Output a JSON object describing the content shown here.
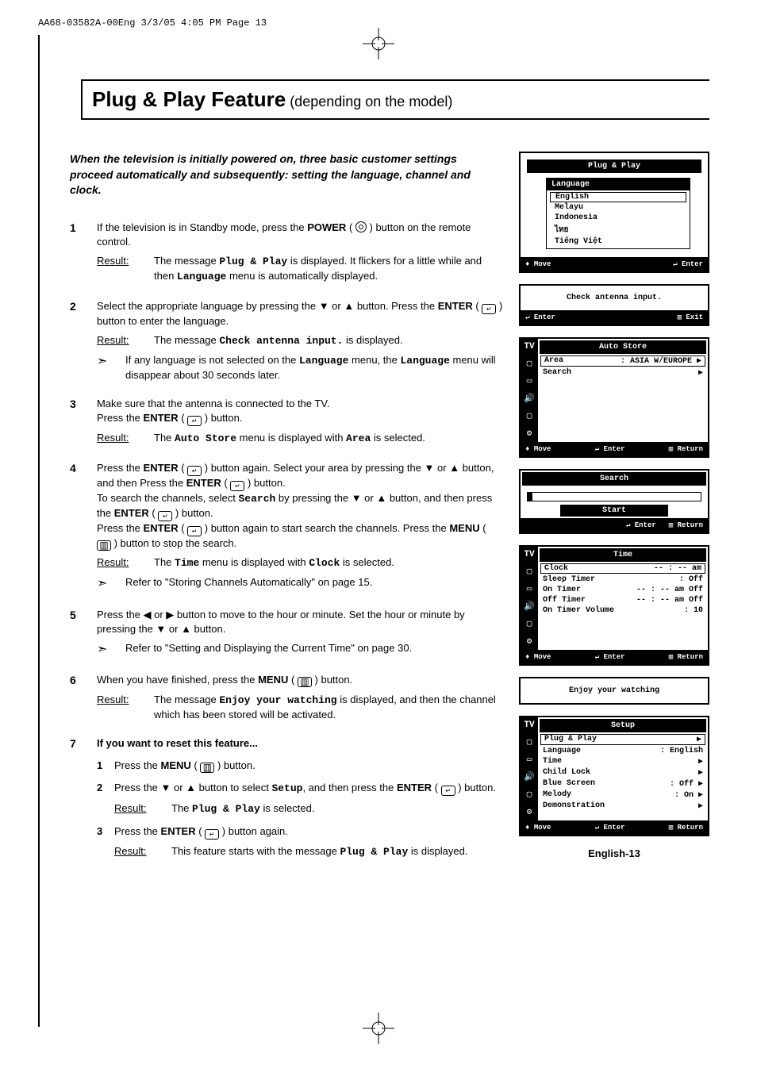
{
  "meta": {
    "header": "AA68-03582A-00Eng  3/3/05  4:05 PM  Page 13"
  },
  "title": {
    "main": "Plug & Play Feature",
    "sub": " (depending on the model)"
  },
  "intro": "When the television is initially powered on, three basic customer settings proceed automatically and subsequently: setting the language, channel and clock.",
  "steps": {
    "s1": {
      "num": "1",
      "body_a": "If the television is in Standby mode, press the ",
      "body_b": "POWER",
      "body_c": " ( ",
      "body_d": " ) button on the remote control.",
      "result_label": "Result:",
      "result_a": "The message ",
      "result_b": "Plug & Play",
      "result_c": " is displayed. It flickers for a little while and then ",
      "result_d": "Language",
      "result_e": " menu is automatically displayed."
    },
    "s2": {
      "num": "2",
      "body_a": "Select the appropriate language by pressing the ▼ or ▲  button. Press the ",
      "body_b": "ENTER",
      "body_c": " ( ",
      "body_d": " ) button to enter the language.",
      "result_label": "Result:",
      "result_a": "The message ",
      "result_b": "Check antenna input.",
      "result_c": " is displayed.",
      "note_a": "If any language is not selected on the ",
      "note_b": "Language",
      "note_c": " menu, the ",
      "note_d": "Language",
      "note_e": " menu will disappear about 30 seconds later."
    },
    "s3": {
      "num": "3",
      "body_a": "Make sure that the antenna is connected to the TV.\nPress the ",
      "body_b": "ENTER",
      "body_c": " ( ",
      "body_d": " ) button.",
      "result_label": "Result:",
      "result_a": "The ",
      "result_b": "Auto Store",
      "result_c": " menu is displayed with ",
      "result_d": "Area",
      "result_e": " is selected."
    },
    "s4": {
      "num": "4",
      "body_a": "Press the ",
      "body_b": "ENTER",
      "body_c": " ( ",
      "body_d": " ) button again. Select your area by pressing the ▼ or ▲ button, and then Press the ",
      "body_e": "ENTER",
      "body_f": " ( ",
      "body_g": " ) button.\nTo search the channels, select ",
      "body_h": "Search",
      "body_i": " by pressing the ▼ or ▲ button, and then press the ",
      "body_j": "ENTER",
      "body_k": " ( ",
      "body_l": " ) button.\nPress the ",
      "body_m": "ENTER",
      "body_n": " ( ",
      "body_o": " ) button again to start search the channels. Press the ",
      "body_p": "MENU",
      "body_q": " ( ",
      "body_r": " ) button to stop the search.",
      "result_label": "Result:",
      "result_a": "The ",
      "result_b": "Time",
      "result_c": " menu is displayed with ",
      "result_d": "Clock",
      "result_e": " is selected.",
      "note": "Refer to \"Storing Channels Automatically\" on page 15."
    },
    "s5": {
      "num": "5",
      "body": "Press the ◀ or ▶ button to move to the hour or minute. Set the hour or minute by pressing the ▼ or ▲  button.",
      "note": "Refer to \"Setting and Displaying the Current Time\" on page 30."
    },
    "s6": {
      "num": "6",
      "body_a": "When you have finished, press the ",
      "body_b": "MENU",
      "body_c": " ( ",
      "body_d": " ) button.",
      "result_label": "Result:",
      "result_a": "The message ",
      "result_b": "Enjoy your watching",
      "result_c": " is displayed, and then the channel which has been stored will be activated."
    },
    "s7": {
      "num": "7",
      "heading": "If you want to reset this feature...",
      "sub1": {
        "num": "1",
        "a": "Press the ",
        "b": "MENU",
        "c": " ( ",
        "d": " ) button."
      },
      "sub2": {
        "num": "2",
        "a": "Press the ▼ or ▲  button to select ",
        "b": "Setup",
        "c": ", and then press the ",
        "d": "ENTER",
        "e": " ( ",
        "f": " ) button.",
        "result_label": "Result:",
        "result_a": "The ",
        "result_b": "Plug & Play",
        "result_c": " is selected."
      },
      "sub3": {
        "num": "3",
        "a": "Press the ",
        "b": "ENTER",
        "c": " ( ",
        "d": " ) button again.",
        "result_label": "Result:",
        "result_a": "This feature starts with the message ",
        "result_b": "Plug & Play",
        "result_c": " is displayed."
      }
    }
  },
  "screens": {
    "pnp": {
      "title": "Plug & Play",
      "lang_title": "Language",
      "langs": [
        "English",
        "Melayu",
        "Indonesia",
        "ไทย",
        "Tiếng Việt"
      ],
      "footer": {
        "move": "Move",
        "enter": "Enter"
      }
    },
    "check": {
      "msg": "Check antenna input.",
      "footer": {
        "enter": "Enter",
        "exit": "Exit"
      }
    },
    "auto": {
      "tv": "TV",
      "title": "Auto Store",
      "area_label": "Area",
      "area_value": ": ASIA W/EUROPE",
      "search": "Search",
      "footer": {
        "move": "Move",
        "enter": "Enter",
        "return": "Return"
      }
    },
    "search": {
      "title": "Search",
      "start": "Start",
      "footer": {
        "enter": "Enter",
        "return": "Return"
      }
    },
    "time": {
      "tv": "TV",
      "title": "Time",
      "rows": [
        {
          "l": "Clock",
          "r": "-- : --  am"
        },
        {
          "l": "Sleep Timer",
          "r": ": Off"
        },
        {
          "l": "On Timer",
          "r": "-- : --  am Off"
        },
        {
          "l": "Off Timer",
          "r": "-- : --  am Off"
        },
        {
          "l": "On Timer Volume",
          "r": ": 10"
        }
      ],
      "footer": {
        "move": "Move",
        "enter": "Enter",
        "return": "Return"
      }
    },
    "enjoy": {
      "msg": "Enjoy your watching"
    },
    "setup": {
      "tv": "TV",
      "title": "Setup",
      "rows": [
        {
          "l": "Plug & Play",
          "r": "▶"
        },
        {
          "l": "Language",
          "r": ": English"
        },
        {
          "l": "Time",
          "r": "▶"
        },
        {
          "l": "Child Lock",
          "r": "▶"
        },
        {
          "l": "Blue Screen",
          "r": ": Off   ▶"
        },
        {
          "l": "Melody",
          "r": ": On    ▶"
        },
        {
          "l": "Demonstration",
          "r": "▶"
        }
      ],
      "footer": {
        "move": "Move",
        "enter": "Enter",
        "return": "Return"
      }
    }
  },
  "page_number": "English-13"
}
